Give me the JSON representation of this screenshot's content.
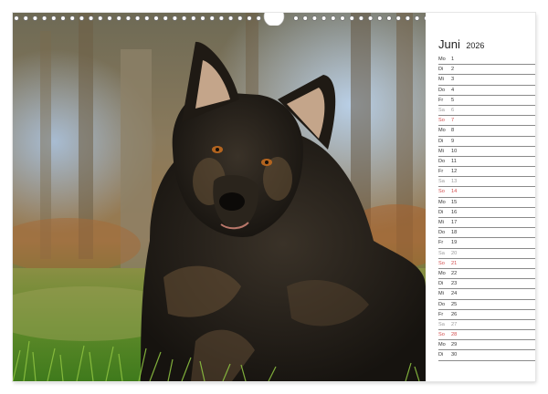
{
  "calendar": {
    "month": "Juni",
    "year": "2026",
    "days": [
      {
        "weekday": "Mo",
        "day": "1",
        "type": "weekday"
      },
      {
        "weekday": "Di",
        "day": "2",
        "type": "weekday"
      },
      {
        "weekday": "Mi",
        "day": "3",
        "type": "weekday"
      },
      {
        "weekday": "Do",
        "day": "4",
        "type": "weekday"
      },
      {
        "weekday": "Fr",
        "day": "5",
        "type": "weekday"
      },
      {
        "weekday": "Sa",
        "day": "6",
        "type": "sat"
      },
      {
        "weekday": "So",
        "day": "7",
        "type": "sun"
      },
      {
        "weekday": "Mo",
        "day": "8",
        "type": "weekday"
      },
      {
        "weekday": "Di",
        "day": "9",
        "type": "weekday"
      },
      {
        "weekday": "Mi",
        "day": "10",
        "type": "weekday"
      },
      {
        "weekday": "Do",
        "day": "11",
        "type": "weekday"
      },
      {
        "weekday": "Fr",
        "day": "12",
        "type": "weekday"
      },
      {
        "weekday": "Sa",
        "day": "13",
        "type": "sat"
      },
      {
        "weekday": "So",
        "day": "14",
        "type": "sun"
      },
      {
        "weekday": "Mo",
        "day": "15",
        "type": "weekday"
      },
      {
        "weekday": "Di",
        "day": "16",
        "type": "weekday"
      },
      {
        "weekday": "Mi",
        "day": "17",
        "type": "weekday"
      },
      {
        "weekday": "Do",
        "day": "18",
        "type": "weekday"
      },
      {
        "weekday": "Fr",
        "day": "19",
        "type": "weekday"
      },
      {
        "weekday": "Sa",
        "day": "20",
        "type": "sat"
      },
      {
        "weekday": "So",
        "day": "21",
        "type": "sun"
      },
      {
        "weekday": "Mo",
        "day": "22",
        "type": "weekday"
      },
      {
        "weekday": "Di",
        "day": "23",
        "type": "weekday"
      },
      {
        "weekday": "Mi",
        "day": "24",
        "type": "weekday"
      },
      {
        "weekday": "Do",
        "day": "25",
        "type": "weekday"
      },
      {
        "weekday": "Fr",
        "day": "26",
        "type": "weekday"
      },
      {
        "weekday": "Sa",
        "day": "27",
        "type": "sat"
      },
      {
        "weekday": "So",
        "day": "28",
        "type": "sun"
      },
      {
        "weekday": "Mo",
        "day": "29",
        "type": "weekday"
      },
      {
        "weekday": "Di",
        "day": "30",
        "type": "weekday"
      }
    ]
  },
  "colors": {
    "sunday": "#d24b4b",
    "saturday": "#9a9a9a",
    "line": "#8a8a8a"
  }
}
